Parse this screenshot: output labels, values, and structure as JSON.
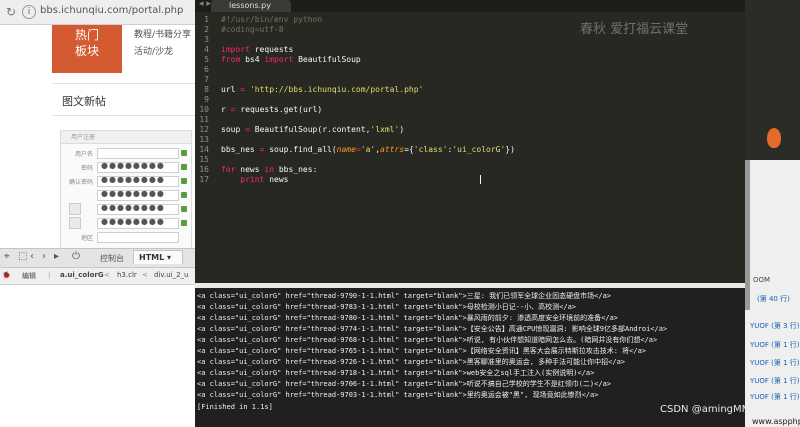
{
  "browser": {
    "url": "bbs.ichunqiu.com/portal.php",
    "hot_block": [
      "热门",
      "板块"
    ],
    "topics": [
      "教程/书籍分享",
      "活动/沙龙"
    ],
    "section_title": "图文新帖",
    "thumb_header": "用户注册",
    "thumb_rows": [
      {
        "label": "用户名",
        "value": ""
      },
      {
        "label": "密码",
        "value": "●●●●●●●●"
      },
      {
        "label": "确认密码",
        "value": "●●●●●●●●"
      },
      {
        "label": "",
        "value": "●●●●●●●●"
      },
      {
        "label": "",
        "value": "●●●●●●●●"
      },
      {
        "label": "",
        "value": "●●●●●●●●"
      },
      {
        "label": "地区",
        "value": ""
      }
    ],
    "devtools": {
      "console_tab": "控制台",
      "html_tab": "HTML",
      "edit": "编辑",
      "crumbs": [
        "a.ui_colorG",
        "h3.clr",
        "div.ui_2_u"
      ]
    }
  },
  "editor": {
    "tab_title": "lessons.py",
    "watermark": "春秋 爱打福云课堂",
    "line_numbers": [
      "1",
      "2",
      "3",
      "4",
      "5",
      "6",
      "7",
      "8",
      "9",
      "10",
      "11",
      "12",
      "13",
      "14",
      "15",
      "16",
      "17"
    ],
    "lines": [
      "#!/usr/bin/env python",
      "#coding=utf-8",
      "",
      "import requests",
      "from bs4 import BeautifulSoup",
      "",
      "",
      "url = 'http://bbs.ichunqiu.com/portal.php'",
      "",
      "r = requests.get(url)",
      "",
      "soup = BeautifulSoup(r.content,'lxml')",
      "",
      "bbs_nes = soup.find_all(name='a',attrs={'class':'ui_colorG'})",
      "",
      "for news in bbs_nes:",
      "    print news"
    ],
    "colors": {
      "background": "#272822",
      "comment": "#75715e",
      "keyword": "#f92672",
      "string": "#e6db74",
      "default": "#f8f8f2",
      "param": "#fd971f"
    }
  },
  "console": {
    "lines": [
      "<a class=\"ui_colorG\" href=\"thread-9790-1-1.html\" target=\"blank\">三星: 我们已领军全球企业固态硬盘市场</a>",
      "<a class=\"ui_colorG\" href=\"thread-9783-1-1.html\" target=\"blank\">母校检测小日记--小、高校测</a>",
      "<a class=\"ui_colorG\" href=\"thread-9780-1-1.html\" target=\"blank\">暴风雨的前夕: 渗透高度安全环境前的准备</a>",
      "<a class=\"ui_colorG\" href=\"thread-9774-1-1.html\" target=\"blank\">【安全公告】高通CPU惊现漏洞: 影响全球9亿多部Androi</a>",
      "<a class=\"ui_colorG\" href=\"thread-9768-1-1.html\" target=\"blank\">听说, 有小伙伴想知道暗网怎么去。(暗网并没有你们想</a>",
      "<a class=\"ui_colorG\" href=\"thread-9765-1-1.html\" target=\"blank\">【网络安全资讯】黑客大会展示特斯拉攻击技术: 将</a>",
      "<a class=\"ui_colorG\" href=\"thread-9726-1-1.html\" target=\"blank\">黑客聊准里的奥运会, 多种手法可能让你中招</a>",
      "<a class=\"ui_colorG\" href=\"thread-9718-1-1.html\" target=\"blank\">web安全之sql手工注入(实例说明)</a>",
      "<a class=\"ui_colorG\" href=\"thread-9706-1-1.html\" target=\"blank\">听说不搞自己学校的学生不是红领巾(二)</a>",
      "<a class=\"ui_colorG\" href=\"thread-9703-1-1.html\" target=\"blank\">里约奥运会被\"黑\", 现场竟如此惨烈</a>",
      "[Finished in 1.1s]"
    ]
  },
  "rightstrip": {
    "items": [
      "OOM",
      "(第 40 行)",
      "YUOF (第 3 行)",
      "YUOF (第 1 行)",
      "YUOF (第 1 行)",
      "YUOF (第 1 行)",
      "YUOF (第 1 行)"
    ]
  },
  "overlay": {
    "csdn": "CSDN @amingMM",
    "site": "www.aspphp.online"
  }
}
